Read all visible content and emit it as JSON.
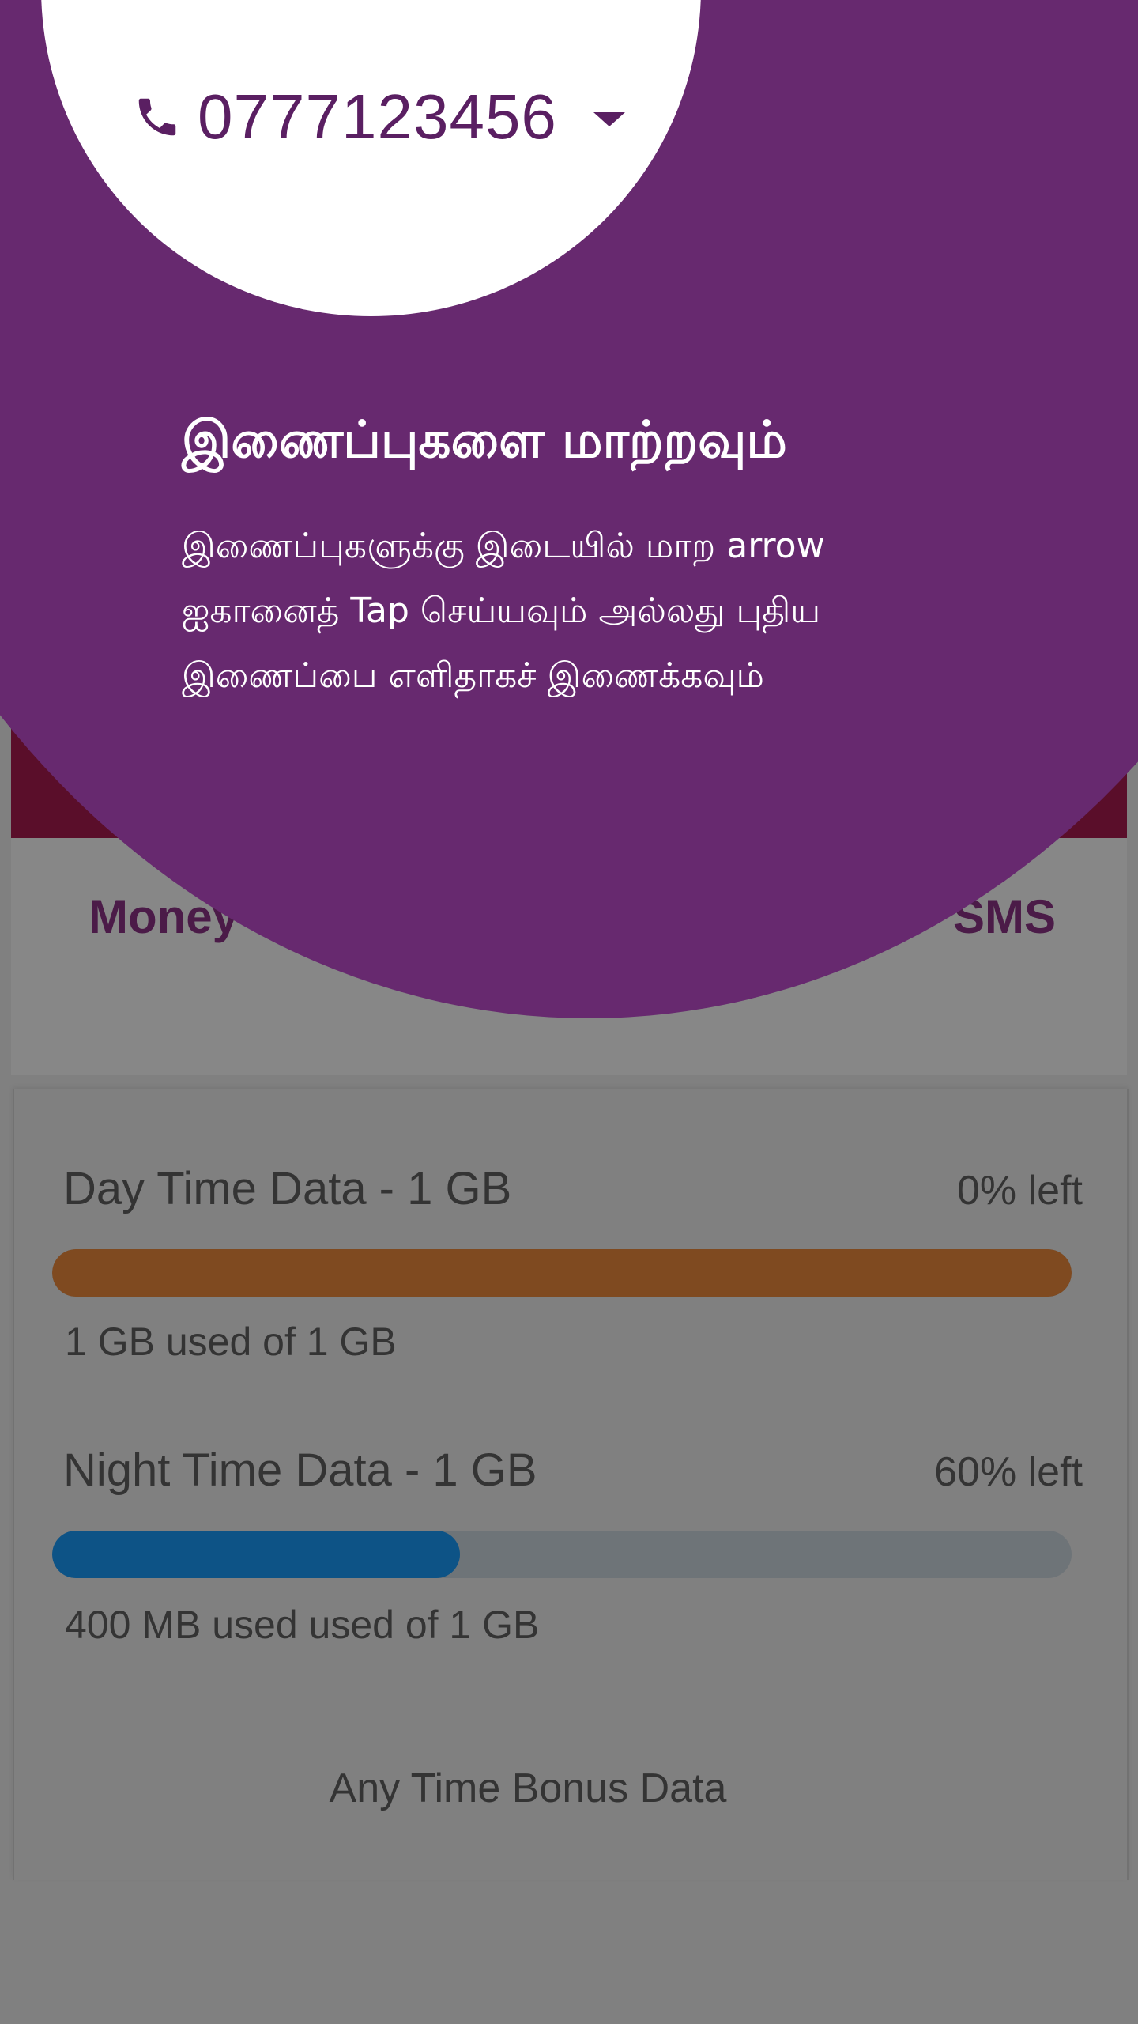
{
  "account": {
    "phone_number": "0777123456"
  },
  "tabs": {
    "money_label": "Money",
    "sms_label": "SMS"
  },
  "usage": {
    "day": {
      "title": "Day Time Data - 1 GB",
      "remaining": "0% left",
      "used_text": "1 GB used of 1 GB",
      "used_fraction": 1.0,
      "bar_color": "#7f4a20"
    },
    "night": {
      "title": "Night Time Data - 1 GB",
      "remaining": "60% left",
      "used_text": "400 MB used used of 1 GB",
      "used_fraction": 0.4,
      "bar_color": "#0d5386"
    },
    "bonus_title": "Any Time Bonus Data"
  },
  "coach_mark": {
    "title": "இணைப்புகளை மாற்றவும்",
    "body": "இணைப்புகளுக்கு இடையில் மாற arrow ஐகானைத் Tap செய்யவும் அல்லது புதிய இணைப்பை எளிதாகச் இணைக்கவும்",
    "background_color": "#67296f"
  },
  "icons": {
    "phone": "phone-icon",
    "dropdown": "chevron-down-icon"
  }
}
